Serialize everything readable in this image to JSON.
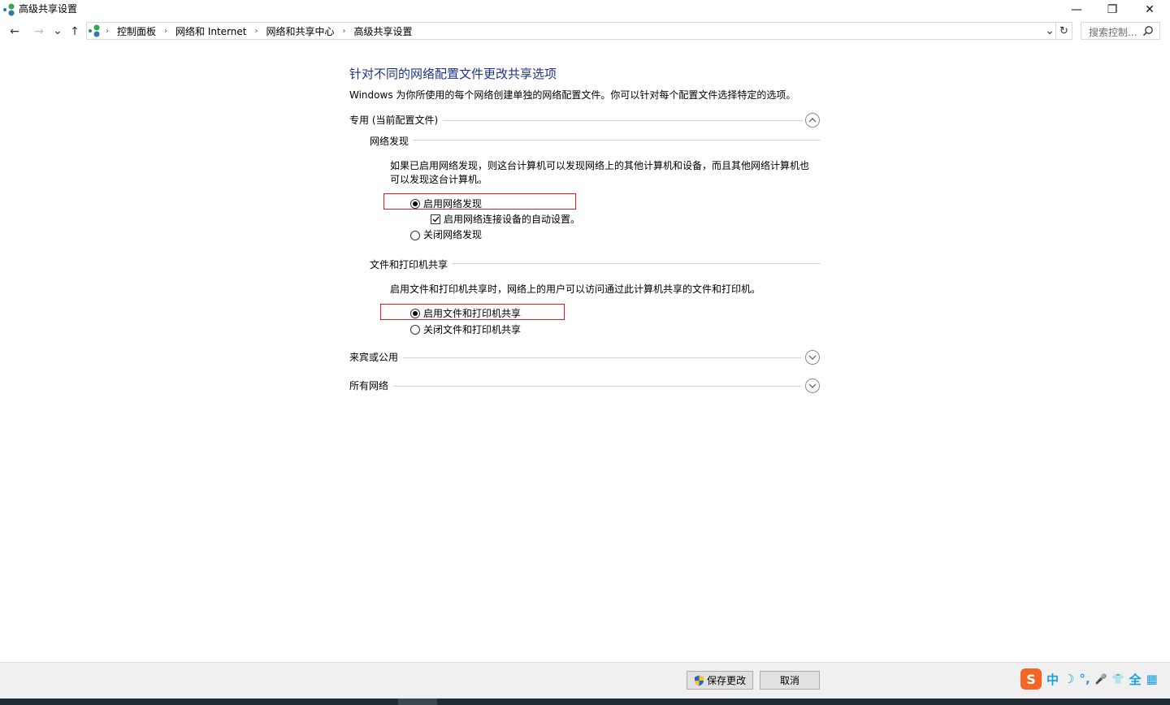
{
  "window": {
    "title": "高级共享设置",
    "minimize_glyph": "—",
    "restore_glyph": "❐",
    "close_glyph": "✕"
  },
  "nav": {
    "back_glyph": "←",
    "forward_glyph": "→",
    "recent_glyph": "⌄",
    "up_glyph": "↑",
    "refresh_glyph": "↻",
    "dropdown_glyph": "⌄"
  },
  "breadcrumb": {
    "separator": "›",
    "items": [
      "控制面板",
      "网络和 Internet",
      "网络和共享中心",
      "高级共享设置"
    ]
  },
  "search": {
    "placeholder": "搜索控制..."
  },
  "main": {
    "heading": "针对不同的网络配置文件更改共享选项",
    "description": "Windows 为你所使用的每个网络创建单独的网络配置文件。你可以针对每个配置文件选择特定的选项。",
    "profiles": {
      "private": {
        "label": "专用 (当前配置文件)",
        "expanded": true
      },
      "guest": {
        "label": "来宾或公用",
        "expanded": false
      },
      "all": {
        "label": "所有网络",
        "expanded": false
      }
    },
    "network_discovery": {
      "title": "网络发现",
      "description_line1": "如果已启用网络发现，则这台计算机可以发现网络上的其他计算机和设备，而且其他网络计算机也",
      "description_line2": "可以发现这台计算机。",
      "enable_label": "启用网络发现",
      "enable_selected": true,
      "auto_setup_label": "启用网络连接设备的自动设置。",
      "auto_setup_checked": true,
      "disable_label": "关闭网络发现"
    },
    "file_sharing": {
      "title": "文件和打印机共享",
      "description": "启用文件和打印机共享时，网络上的用户可以访问通过此计算机共享的文件和打印机。",
      "enable_label": "启用文件和打印机共享",
      "enable_selected": true,
      "disable_label": "关闭文件和打印机共享"
    }
  },
  "footer": {
    "save_label": "保存更改",
    "cancel_label": "取消"
  },
  "ime": {
    "logo": "S",
    "items": [
      "中",
      "☽",
      "°,",
      "🎤",
      "👕",
      "全",
      "▦"
    ]
  },
  "colors": {
    "heading": "#1e3287",
    "highlight_box": "#e02020",
    "taskbar": "#1f2a33"
  }
}
